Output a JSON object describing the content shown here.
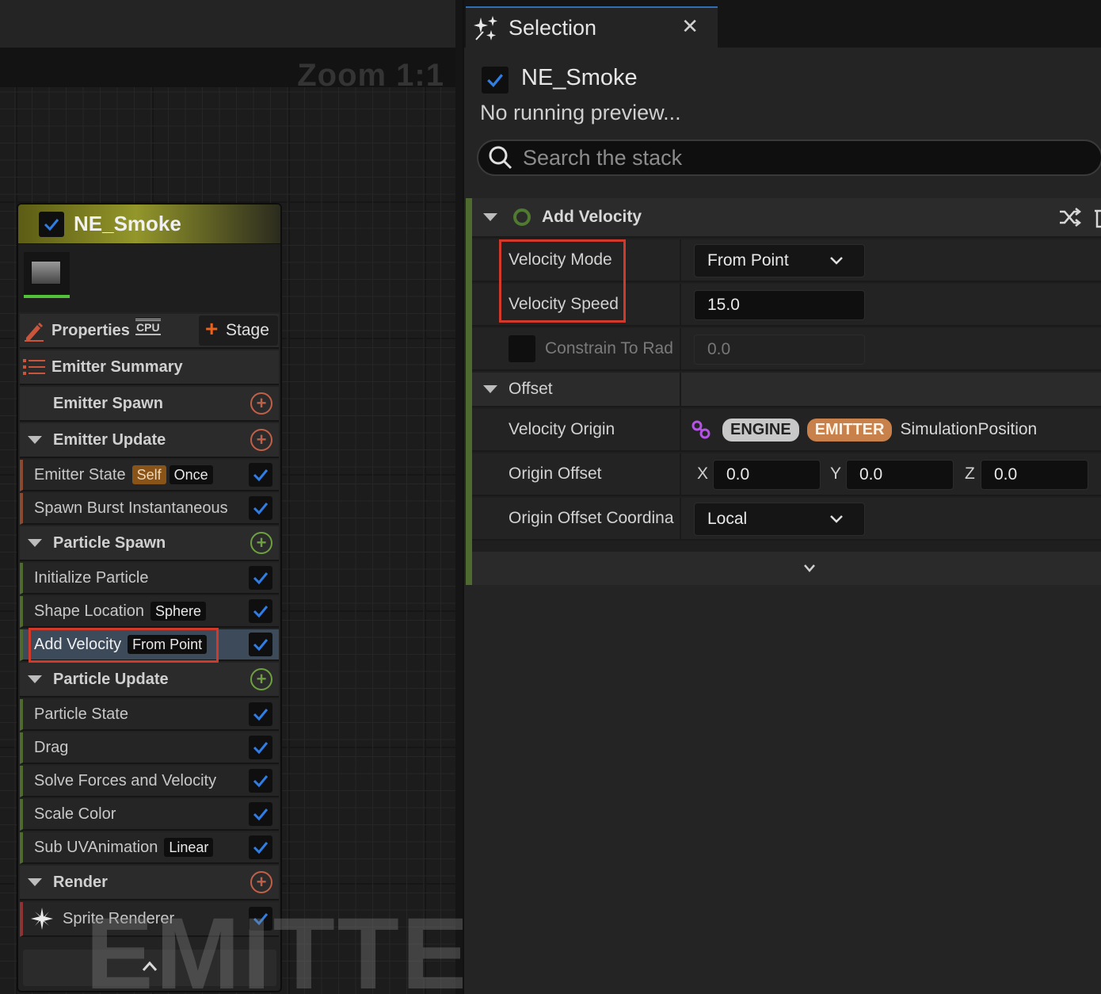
{
  "graph": {
    "zoom_label": "Zoom 1:1",
    "watermark": "EMITTER"
  },
  "node": {
    "title": "NE_Smoke",
    "properties_label": "Properties",
    "cpu_label": "CPU",
    "stage_label": "Stage",
    "emitter_summary_label": "Emitter Summary",
    "groups": {
      "emitter_spawn": "Emitter Spawn",
      "emitter_update": "Emitter Update",
      "particle_spawn": "Particle Spawn",
      "particle_update": "Particle Update",
      "render": "Render"
    },
    "modules": {
      "emitter_state": {
        "label": "Emitter State",
        "tag1": "Self",
        "tag2": "Once"
      },
      "spawn_burst": {
        "label": "Spawn Burst Instantaneous"
      },
      "initialize_particle": {
        "label": "Initialize Particle"
      },
      "shape_location": {
        "label": "Shape Location",
        "tag": "Sphere"
      },
      "add_velocity": {
        "label": "Add Velocity",
        "tag": "From Point"
      },
      "particle_state": {
        "label": "Particle State"
      },
      "drag": {
        "label": "Drag"
      },
      "solve_forces": {
        "label": "Solve Forces and Velocity"
      },
      "scale_color": {
        "label": "Scale Color"
      },
      "sub_uv": {
        "label": "Sub UVAnimation",
        "tag": "Linear"
      },
      "sprite_renderer": {
        "label": "Sprite Renderer"
      }
    }
  },
  "panel": {
    "tab_title": "Selection",
    "emitter_name": "NE_Smoke",
    "preview_text": "No running preview...",
    "search_placeholder": "Search the stack",
    "module_title": "Add Velocity",
    "velocity_mode": {
      "label": "Velocity Mode",
      "value": "From Point"
    },
    "velocity_speed": {
      "label": "Velocity Speed",
      "value": "15.0"
    },
    "constrain": {
      "label": "Constrain To Rad",
      "value": "0.0"
    },
    "offset_label": "Offset",
    "velocity_origin": {
      "label": "Velocity Origin",
      "pill1": "ENGINE",
      "pill2": "EMITTER",
      "value": "SimulationPosition"
    },
    "origin_offset": {
      "label": "Origin Offset",
      "x_label": "X",
      "x": "0.0",
      "y_label": "Y",
      "y": "0.0",
      "z_label": "Z",
      "z": "0.0"
    },
    "origin_offset_coord": {
      "label": "Origin Offset Coordina",
      "value": "Local"
    }
  },
  "colors": {
    "accent_blue": "#2f7ee6",
    "highlight_red": "#d13a2a",
    "emitter_green": "#53c13a"
  }
}
